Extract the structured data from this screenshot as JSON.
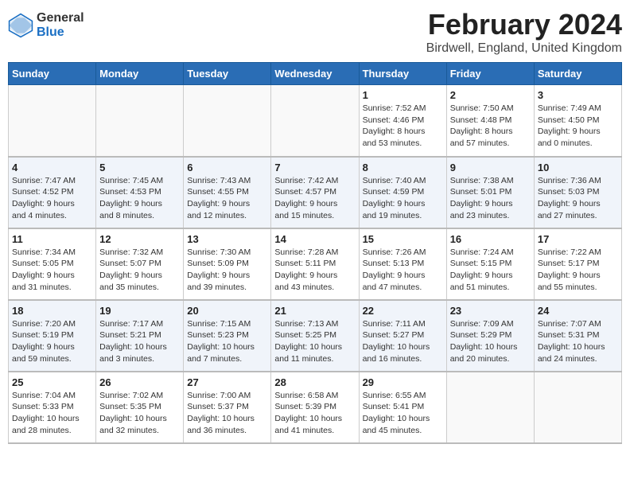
{
  "header": {
    "logo_general": "General",
    "logo_blue": "Blue",
    "title": "February 2024",
    "subtitle": "Birdwell, England, United Kingdom"
  },
  "days_of_week": [
    "Sunday",
    "Monday",
    "Tuesday",
    "Wednesday",
    "Thursday",
    "Friday",
    "Saturday"
  ],
  "weeks": [
    [
      {
        "day": "",
        "info": ""
      },
      {
        "day": "",
        "info": ""
      },
      {
        "day": "",
        "info": ""
      },
      {
        "day": "",
        "info": ""
      },
      {
        "day": "1",
        "info": "Sunrise: 7:52 AM\nSunset: 4:46 PM\nDaylight: 8 hours\nand 53 minutes."
      },
      {
        "day": "2",
        "info": "Sunrise: 7:50 AM\nSunset: 4:48 PM\nDaylight: 8 hours\nand 57 minutes."
      },
      {
        "day": "3",
        "info": "Sunrise: 7:49 AM\nSunset: 4:50 PM\nDaylight: 9 hours\nand 0 minutes."
      }
    ],
    [
      {
        "day": "4",
        "info": "Sunrise: 7:47 AM\nSunset: 4:52 PM\nDaylight: 9 hours\nand 4 minutes."
      },
      {
        "day": "5",
        "info": "Sunrise: 7:45 AM\nSunset: 4:53 PM\nDaylight: 9 hours\nand 8 minutes."
      },
      {
        "day": "6",
        "info": "Sunrise: 7:43 AM\nSunset: 4:55 PM\nDaylight: 9 hours\nand 12 minutes."
      },
      {
        "day": "7",
        "info": "Sunrise: 7:42 AM\nSunset: 4:57 PM\nDaylight: 9 hours\nand 15 minutes."
      },
      {
        "day": "8",
        "info": "Sunrise: 7:40 AM\nSunset: 4:59 PM\nDaylight: 9 hours\nand 19 minutes."
      },
      {
        "day": "9",
        "info": "Sunrise: 7:38 AM\nSunset: 5:01 PM\nDaylight: 9 hours\nand 23 minutes."
      },
      {
        "day": "10",
        "info": "Sunrise: 7:36 AM\nSunset: 5:03 PM\nDaylight: 9 hours\nand 27 minutes."
      }
    ],
    [
      {
        "day": "11",
        "info": "Sunrise: 7:34 AM\nSunset: 5:05 PM\nDaylight: 9 hours\nand 31 minutes."
      },
      {
        "day": "12",
        "info": "Sunrise: 7:32 AM\nSunset: 5:07 PM\nDaylight: 9 hours\nand 35 minutes."
      },
      {
        "day": "13",
        "info": "Sunrise: 7:30 AM\nSunset: 5:09 PM\nDaylight: 9 hours\nand 39 minutes."
      },
      {
        "day": "14",
        "info": "Sunrise: 7:28 AM\nSunset: 5:11 PM\nDaylight: 9 hours\nand 43 minutes."
      },
      {
        "day": "15",
        "info": "Sunrise: 7:26 AM\nSunset: 5:13 PM\nDaylight: 9 hours\nand 47 minutes."
      },
      {
        "day": "16",
        "info": "Sunrise: 7:24 AM\nSunset: 5:15 PM\nDaylight: 9 hours\nand 51 minutes."
      },
      {
        "day": "17",
        "info": "Sunrise: 7:22 AM\nSunset: 5:17 PM\nDaylight: 9 hours\nand 55 minutes."
      }
    ],
    [
      {
        "day": "18",
        "info": "Sunrise: 7:20 AM\nSunset: 5:19 PM\nDaylight: 9 hours\nand 59 minutes."
      },
      {
        "day": "19",
        "info": "Sunrise: 7:17 AM\nSunset: 5:21 PM\nDaylight: 10 hours\nand 3 minutes."
      },
      {
        "day": "20",
        "info": "Sunrise: 7:15 AM\nSunset: 5:23 PM\nDaylight: 10 hours\nand 7 minutes."
      },
      {
        "day": "21",
        "info": "Sunrise: 7:13 AM\nSunset: 5:25 PM\nDaylight: 10 hours\nand 11 minutes."
      },
      {
        "day": "22",
        "info": "Sunrise: 7:11 AM\nSunset: 5:27 PM\nDaylight: 10 hours\nand 16 minutes."
      },
      {
        "day": "23",
        "info": "Sunrise: 7:09 AM\nSunset: 5:29 PM\nDaylight: 10 hours\nand 20 minutes."
      },
      {
        "day": "24",
        "info": "Sunrise: 7:07 AM\nSunset: 5:31 PM\nDaylight: 10 hours\nand 24 minutes."
      }
    ],
    [
      {
        "day": "25",
        "info": "Sunrise: 7:04 AM\nSunset: 5:33 PM\nDaylight: 10 hours\nand 28 minutes."
      },
      {
        "day": "26",
        "info": "Sunrise: 7:02 AM\nSunset: 5:35 PM\nDaylight: 10 hours\nand 32 minutes."
      },
      {
        "day": "27",
        "info": "Sunrise: 7:00 AM\nSunset: 5:37 PM\nDaylight: 10 hours\nand 36 minutes."
      },
      {
        "day": "28",
        "info": "Sunrise: 6:58 AM\nSunset: 5:39 PM\nDaylight: 10 hours\nand 41 minutes."
      },
      {
        "day": "29",
        "info": "Sunrise: 6:55 AM\nSunset: 5:41 PM\nDaylight: 10 hours\nand 45 minutes."
      },
      {
        "day": "",
        "info": ""
      },
      {
        "day": "",
        "info": ""
      }
    ]
  ]
}
